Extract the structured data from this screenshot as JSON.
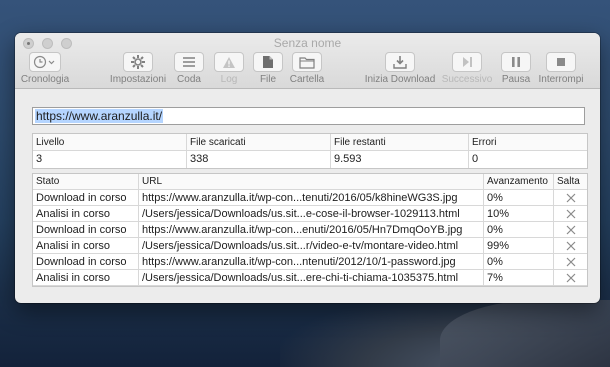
{
  "window": {
    "title": "Senza nome"
  },
  "toolbar": {
    "cronologia": "Cronologia",
    "impostazioni": "Impostazioni",
    "coda": "Coda",
    "log": "Log",
    "file": "File",
    "cartella": "Cartella",
    "inizia_download": "Inizia Download",
    "successivo": "Successivo",
    "pausa": "Pausa",
    "interrompi": "Interrompi"
  },
  "url_field": {
    "value": "https://www.aranzulla.it/"
  },
  "stats": {
    "headers": [
      "Livello",
      "File scaricati",
      "File restanti",
      "Errori"
    ],
    "values": [
      "3",
      "338",
      "9.593",
      "0"
    ]
  },
  "downloads": {
    "headers": {
      "stato": "Stato",
      "url": "URL",
      "avanzamento": "Avanzamento",
      "salta": "Salta"
    },
    "rows": [
      {
        "stato": "Download in corso",
        "url": "https://www.aranzulla.it/wp-con...tenuti/2016/05/k8hineWG3S.jpg",
        "avanzamento": "0%"
      },
      {
        "stato": "Analisi in corso",
        "url": "/Users/jessica/Downloads/us.sit...e-cose-il-browser-1029113.html",
        "avanzamento": "10%"
      },
      {
        "stato": "Download in corso",
        "url": "https://www.aranzulla.it/wp-con...enuti/2016/05/Hn7DmqOoYB.jpg",
        "avanzamento": "0%"
      },
      {
        "stato": "Analisi in corso",
        "url": "/Users/jessica/Downloads/us.sit...r/video-e-tv/montare-video.html",
        "avanzamento": "99%"
      },
      {
        "stato": "Download in corso",
        "url": "https://www.aranzulla.it/wp-con...ntenuti/2012/10/1-password.jpg",
        "avanzamento": "0%"
      },
      {
        "stato": "Analisi in corso",
        "url": "/Users/jessica/Downloads/us.sit...ere-chi-ti-chiama-1035375.html",
        "avanzamento": "7%"
      }
    ]
  }
}
